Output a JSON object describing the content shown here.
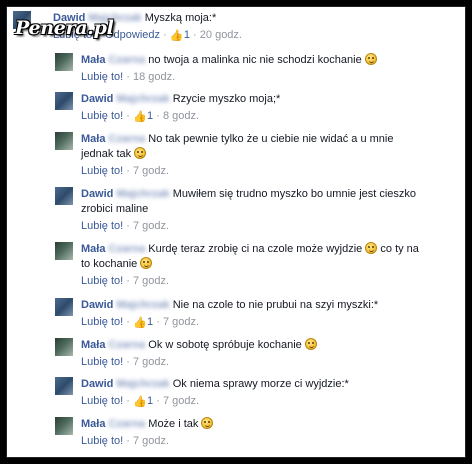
{
  "watermark": "Penera.pl",
  "comments": [
    {
      "author_first": "Dawid",
      "author_last": "Majchrzak",
      "text": "Myszką moja:*",
      "actions": [
        "Lubię to!",
        "Odpowiedz"
      ],
      "likes": "1",
      "time": "20 godz.",
      "emoji": false
    },
    {
      "author_first": "Mała",
      "author_last": "Czarna",
      "text": "no twoja a malinka nic nie schodzi kochanie",
      "like": "Lubię to!",
      "likes": "",
      "time": "18 godz.",
      "emoji": true
    },
    {
      "author_first": "Dawid",
      "author_last": "Majchrzak",
      "text": "Rzycie myszko moja;*",
      "like": "Lubię to!",
      "likes": "1",
      "time": "8 godz.",
      "emoji": false
    },
    {
      "author_first": "Mała",
      "author_last": "Czarna",
      "text": "No tak pewnie tylko że u ciebie nie widać a u mnie jednak tak",
      "like": "Lubię to!",
      "likes": "",
      "time": "7 godz.",
      "emoji": true
    },
    {
      "author_first": "Dawid",
      "author_last": "Majchrzak",
      "text": "Muwiłem się trudno myszko bo umnie jest cieszko zrobici maline",
      "like": "Lubię to!",
      "likes": "",
      "time": "7 godz.",
      "emoji": false
    },
    {
      "author_first": "Mała",
      "author_last": "Czarna",
      "text": "Kurdę teraz zrobię ci na czole może wyjdzie",
      "text2": "co ty na to kochanie",
      "like": "Lubię to!",
      "likes": "",
      "time": "7 godz.",
      "emoji": true
    },
    {
      "author_first": "Dawid",
      "author_last": "Majchrzak",
      "text": "Nie na czole to nie prubui na szyi myszki:*",
      "like": "Lubię to!",
      "likes": "1",
      "time": "7 godz.",
      "emoji": false
    },
    {
      "author_first": "Mała",
      "author_last": "Czarna",
      "text": "Ok w sobotę spróbuje kochanie",
      "like": "Lubię to!",
      "likes": "",
      "time": "7 godz.",
      "emoji": true
    },
    {
      "author_first": "Dawid",
      "author_last": "Majchrzak",
      "text": "Ok niema sprawy morze ci wyjdzie:*",
      "like": "Lubię to!",
      "likes": "1",
      "time": "7 godz.",
      "emoji": false
    },
    {
      "author_first": "Mała",
      "author_last": "Czarna",
      "text": "Może i tak",
      "like": "Lubię to!",
      "likes": "",
      "time": "7 godz.",
      "emoji": true
    }
  ]
}
